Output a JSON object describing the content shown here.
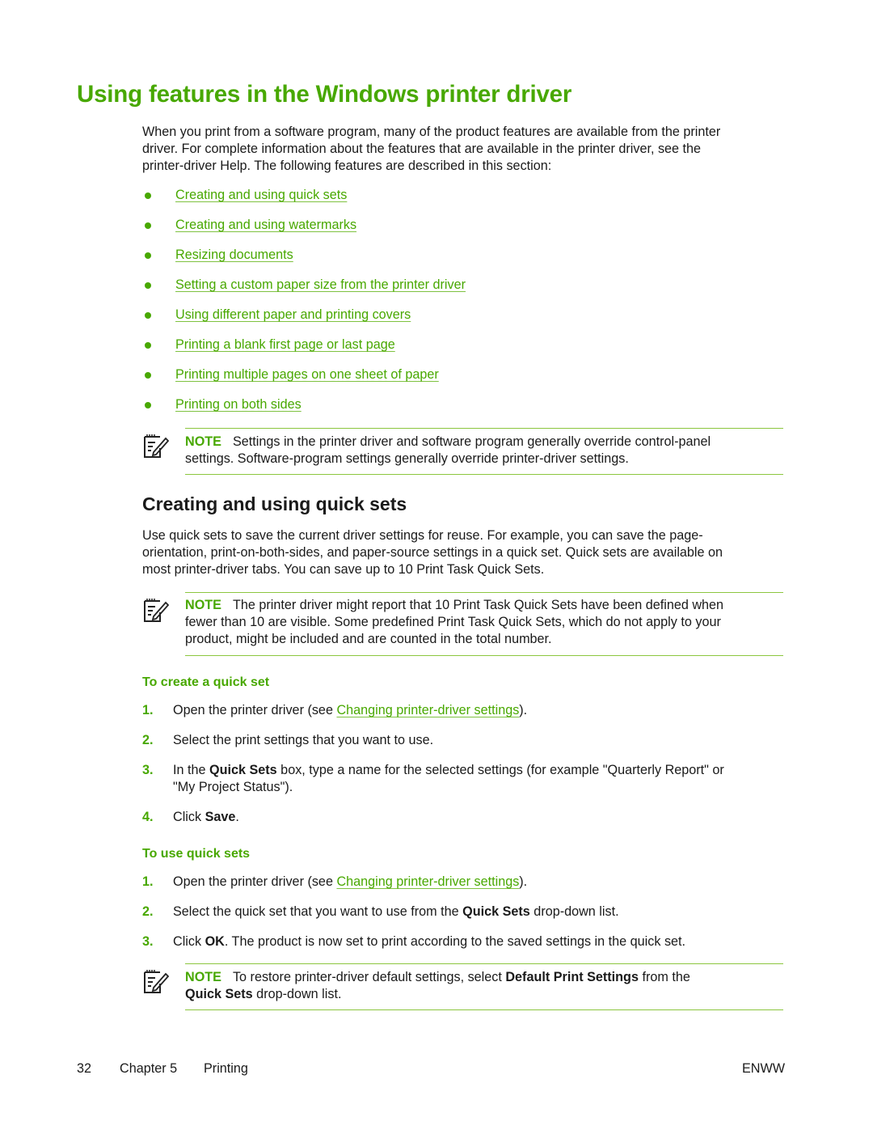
{
  "page": {
    "title": "Using features in the Windows printer driver",
    "intro": "When you print from a software program, many of the product features are available from the printer driver. For complete information about the features that are available in the printer driver, see the printer-driver Help. The following features are described in this section:",
    "intro_lines": [
      "When you print from a software program, many of the product features are available from the printer",
      "driver. For complete information about the features that are available in the printer driver, see the",
      "printer-driver Help. The following features are described in this section:"
    ],
    "feature_links": [
      "Creating and using quick sets",
      "Creating and using watermarks",
      "Resizing documents",
      "Setting a custom paper size from the printer driver",
      "Using different paper and printing covers",
      "Printing a blank first page or last page",
      "Printing multiple pages on one sheet of paper",
      "Printing on both sides"
    ],
    "note1": {
      "label": "NOTE",
      "line1": "Settings in the printer driver and software program generally override control-panel",
      "line2": "settings. Software-program settings generally override printer-driver settings."
    }
  },
  "section": {
    "title": "Creating and using quick sets",
    "intro_lines": [
      "Use quick sets to save the current driver settings for reuse. For example, you can save the page-",
      "orientation, print-on-both-sides, and paper-source settings in a quick set. Quick sets are available on",
      "most printer-driver tabs. You can save up to 10 Print Task Quick Sets."
    ],
    "note2": {
      "label": "NOTE",
      "line1": "The printer driver might report that 10 Print Task Quick Sets have been defined when",
      "line2": "fewer than 10 are visible. Some predefined Print Task Quick Sets, which do not apply to your",
      "line3": "product, might be included and are counted in the total number."
    },
    "create": {
      "title": "To create a quick set",
      "steps": [
        {
          "num": "1.",
          "pre": "Open the printer driver (see ",
          "link": "Changing printer-driver settings",
          "post": ")."
        },
        {
          "num": "2.",
          "text": "Select the print settings that you want to use."
        },
        {
          "num": "3.",
          "pre": "In the ",
          "bold": "Quick Sets",
          "post_line1": " box, type a name for the selected settings (for example \"Quarterly Report\" or",
          "line2": "\"My Project Status\")."
        },
        {
          "num": "4.",
          "pre": "Click ",
          "bold": "Save",
          "post": "."
        }
      ]
    },
    "use": {
      "title": "To use quick sets",
      "steps": [
        {
          "num": "1.",
          "pre": "Open the printer driver (see ",
          "link": "Changing printer-driver settings",
          "post": ")."
        },
        {
          "num": "2.",
          "pre": "Select the quick set that you want to use from the ",
          "bold": "Quick Sets",
          "post": " drop-down list."
        },
        {
          "num": "3.",
          "pre": "Click ",
          "bold": "OK",
          "post": ". The product is now set to print according to the saved settings in the quick set."
        }
      ]
    },
    "note3": {
      "label": "NOTE",
      "pre": "To restore printer-driver default settings, select ",
      "bold1": "Default Print Settings",
      "mid": " from the",
      "bold2": "Quick Sets",
      "post": " drop-down list."
    }
  },
  "footer": {
    "page_number": "32",
    "chapter": "Chapter 5",
    "chapter_title": "Printing",
    "locale": "ENWW"
  },
  "colors": {
    "accent": "#48a800",
    "rule": "#8cc63f",
    "text": "#1a1a1a"
  }
}
